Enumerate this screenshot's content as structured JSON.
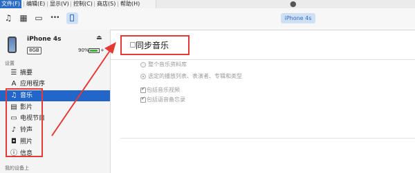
{
  "menu": {
    "items": [
      {
        "label": "文件(F)",
        "active": true
      },
      {
        "label": "编辑(E)",
        "active": false
      },
      {
        "label": "显示(V)",
        "active": false
      },
      {
        "label": "控制(C)",
        "active": false
      },
      {
        "label": "商店(S)",
        "active": false
      },
      {
        "label": "帮助(H)",
        "active": false
      }
    ]
  },
  "toolbar": {
    "icons": [
      "music-icon",
      "film-icon",
      "tv-icon",
      "more-icon",
      "iphone-icon"
    ],
    "more_label": "•••",
    "device_tab": "iPhone 4s"
  },
  "device": {
    "name": "iPhone 4s",
    "capacity": "8GB",
    "battery": "90%",
    "battery_level": 0.9,
    "eject": "⏏"
  },
  "sidebar": {
    "settings_label": "设置",
    "items": [
      {
        "icon": "summary-icon",
        "glyph": "☰",
        "label": "摘要"
      },
      {
        "icon": "apps-icon",
        "glyph": "A",
        "label": "应用程序"
      },
      {
        "icon": "music-icon",
        "glyph": "♫",
        "label": "音乐",
        "selected": true
      },
      {
        "icon": "movies-icon",
        "glyph": "▤",
        "label": "影片"
      },
      {
        "icon": "tv-icon",
        "glyph": "▭",
        "label": "电视节目"
      },
      {
        "icon": "bell-icon",
        "glyph": "♪",
        "label": "铃声"
      },
      {
        "icon": "camera-icon",
        "glyph": "◘",
        "label": "照片"
      },
      {
        "icon": "info-icon",
        "glyph": "ⓘ",
        "label": "信息"
      }
    ],
    "on_device_label": "我的设备上"
  },
  "main": {
    "sync_label": "同步音乐",
    "sync_checked": false,
    "options": [
      {
        "type": "radio",
        "label": "整个音乐资料库",
        "checked": false
      },
      {
        "type": "radio",
        "label": "选定的播放列表、表演者、专辑和类型",
        "checked": true
      },
      {
        "type": "checkbox",
        "label": "包括音乐视频",
        "checked": true
      },
      {
        "type": "checkbox",
        "label": "包括语音备忘录",
        "checked": true
      }
    ]
  },
  "colors": {
    "accent": "#2166c8",
    "annotation": "#e53935"
  }
}
